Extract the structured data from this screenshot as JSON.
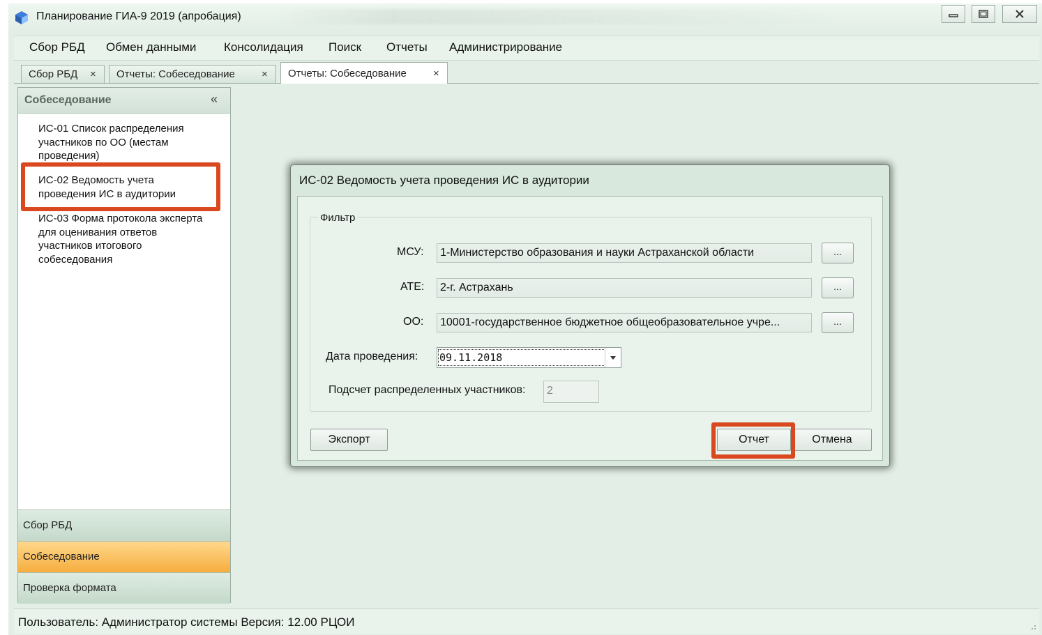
{
  "window": {
    "title": "Планирование ГИА-9 2019 (апробация)"
  },
  "menu": {
    "items": [
      "Сбор РБД",
      "Обмен данными",
      "Консолидация",
      "Поиск",
      "Отчеты",
      "Администрирование"
    ]
  },
  "tabs": [
    {
      "label": "Сбор РБД",
      "active": false
    },
    {
      "label": "Отчеты: Собеседование",
      "active": false
    },
    {
      "label": "Отчеты: Собеседование",
      "active": true
    }
  ],
  "tab_close_glyph": "×",
  "sidebar": {
    "title": "Собеседование",
    "collapse_glyph": "«",
    "reports": [
      {
        "lines": [
          "ИС-01 Список распределения",
          "участников по ОО (местам",
          "проведения)"
        ]
      },
      {
        "lines": [
          "ИС-02 Ведомость учета",
          "проведения ИС в аудитории"
        ]
      },
      {
        "lines": [
          "ИС-03 Форма протокола эксперта",
          "для оценивания ответов",
          "участников итогового",
          "собеседования"
        ]
      }
    ],
    "nav": [
      {
        "label": "Сбор РБД",
        "active": false
      },
      {
        "label": "Собеседование",
        "active": true
      },
      {
        "label": "Проверка формата",
        "active": false
      }
    ]
  },
  "dialog": {
    "title": "ИС-02 Ведомость учета проведения ИС в аудитории",
    "filter_legend": "Фильтр",
    "msu_label": "МСУ:",
    "msu_value": "1-Министерство образования и науки Астраханской области",
    "ate_label": "АТЕ:",
    "ate_value": "2-г. Астрахань",
    "oo_label": "ОО:",
    "oo_value": "10001-государственное бюджетное общеобразовательное учре...",
    "browse_label": "...",
    "date_label": "Дата проведения:",
    "date_value": "09.11.2018",
    "count_label": "Подсчет распределенных участников:",
    "count_value": "2",
    "export_label": "Экспорт",
    "report_label": "Отчет",
    "cancel_label": "Отмена"
  },
  "status": {
    "text": "Пользователь: Администратор системы  Версия: 12.00  РЦОИ"
  },
  "colors": {
    "background": "#e3efe6",
    "highlight": "#d9481f",
    "active_nav": "#f6ad3e"
  }
}
